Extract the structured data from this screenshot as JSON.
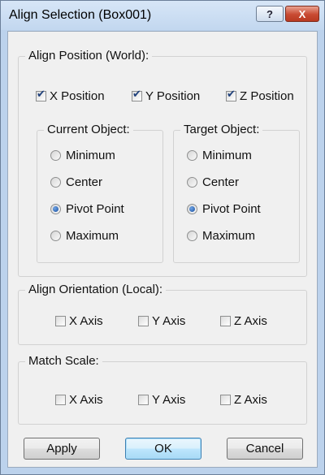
{
  "window": {
    "title": "Align Selection (Box001)",
    "help_glyph": "?",
    "close_glyph": "X"
  },
  "align_position": {
    "label": "Align Position (World):",
    "checkboxes": [
      {
        "label": "X Position",
        "checked": true
      },
      {
        "label": "Y Position",
        "checked": true
      },
      {
        "label": "Z Position",
        "checked": true
      }
    ],
    "current_object": {
      "label": "Current Object:",
      "options": [
        "Minimum",
        "Center",
        "Pivot Point",
        "Maximum"
      ],
      "selected": "Pivot Point"
    },
    "target_object": {
      "label": "Target Object:",
      "options": [
        "Minimum",
        "Center",
        "Pivot Point",
        "Maximum"
      ],
      "selected": "Pivot Point"
    }
  },
  "align_orientation": {
    "label": "Align Orientation (Local):",
    "checkboxes": [
      {
        "label": "X Axis",
        "checked": false
      },
      {
        "label": "Y Axis",
        "checked": false
      },
      {
        "label": "Z Axis",
        "checked": false
      }
    ]
  },
  "match_scale": {
    "label": "Match Scale:",
    "checkboxes": [
      {
        "label": "X Axis",
        "checked": false
      },
      {
        "label": "Y Axis",
        "checked": false
      },
      {
        "label": "Z Axis",
        "checked": false
      }
    ]
  },
  "buttons": {
    "apply": "Apply",
    "ok": "OK",
    "cancel": "Cancel"
  },
  "colors": {
    "frame": "#bcd2ec",
    "client": "#f0f0f0",
    "close_button": "#c84a32",
    "default_button": "#bee6fd"
  }
}
